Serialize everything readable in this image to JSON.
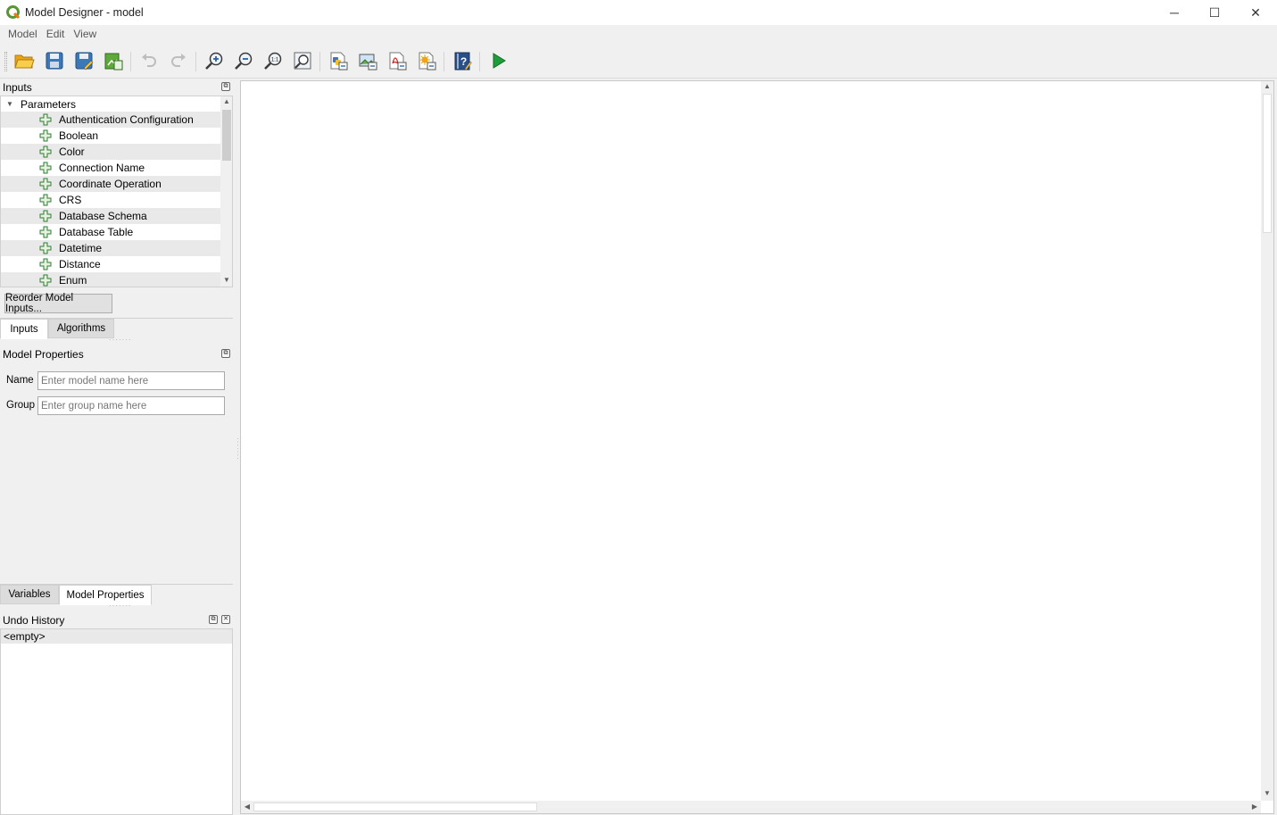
{
  "window": {
    "title": "Model Designer - model",
    "minimize_icon": "─",
    "maximize_icon": "☐",
    "close_icon": "✕"
  },
  "menu": [
    "Model",
    "Edit",
    "View"
  ],
  "toolbar_icons": [
    "open-model",
    "save-model",
    "save-as-model",
    "save-in-project",
    "undo",
    "redo",
    "zoom-in",
    "zoom-out",
    "zoom-actual",
    "zoom-full",
    "export-python",
    "export-image",
    "export-pdf",
    "export-svg",
    "edit-help",
    "run-model"
  ],
  "inputs_panel": {
    "title": "Inputs",
    "tree_parent": "Parameters",
    "items": [
      "Authentication Configuration",
      "Boolean",
      "Color",
      "Connection Name",
      "Coordinate Operation",
      "CRS",
      "Database Schema",
      "Database Table",
      "Datetime",
      "Distance",
      "Enum"
    ],
    "reorder_button": "Reorder Model Inputs...",
    "tabs": [
      "Inputs",
      "Algorithms"
    ]
  },
  "model_properties": {
    "title": "Model Properties",
    "name_label": "Name",
    "name_placeholder": "Enter model name here",
    "group_label": "Group",
    "group_placeholder": "Enter group name here",
    "tabs": [
      "Variables",
      "Model Properties"
    ]
  },
  "undo_history": {
    "title": "Undo History",
    "entry": "<empty>"
  },
  "colors": {
    "accent_green": "#2e7d32",
    "run_green": "#1e9e3a",
    "folder_yellow": "#f2c233",
    "disk_blue": "#3b78b8"
  }
}
